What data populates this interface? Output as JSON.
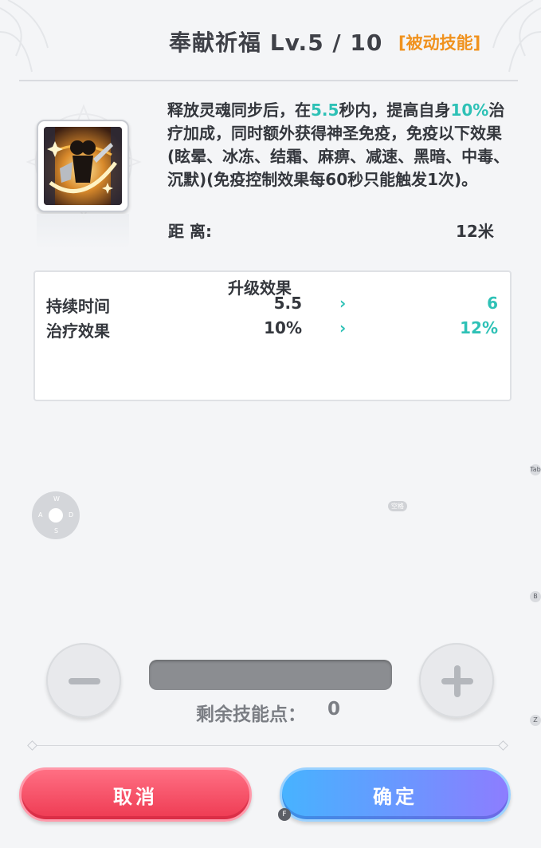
{
  "header": {
    "skill_name": "奉献祈福 Lv.5 / 10",
    "skill_type": "[被动技能]"
  },
  "skill": {
    "icon": "sword-swing-skill-icon",
    "description": [
      {
        "text": "释放灵魂同步后，在",
        "highlight": false
      },
      {
        "text": "5.5",
        "highlight": true
      },
      {
        "text": "秒内，提高自身",
        "highlight": false
      },
      {
        "text": "10%",
        "highlight": true
      },
      {
        "text": "治疗加成，同时额外获得神圣免疫，免疫以下效果(眩晕、冰冻、结霜、麻痹、减速、黑暗、中毒、沉默)(免疫控制效果每60秒只能触发1次)。",
        "highlight": false
      }
    ],
    "range_label": "距  离:",
    "range_value": "12米"
  },
  "upgrade": {
    "title": "升级效果",
    "rows": [
      {
        "label": "持续时间",
        "current": "5.5",
        "arrow": "›",
        "next": "6"
      },
      {
        "label": "治疗效果",
        "current": "10%",
        "arrow": "›",
        "next": "12%"
      }
    ]
  },
  "controls": {
    "wasd": {
      "w": "W",
      "a": "A",
      "s": "S",
      "d": "D"
    },
    "space_hint": "空格",
    "side_keys": [
      "Tab",
      "B",
      "Z"
    ],
    "points_label": "剩余技能点：",
    "points_value": "0",
    "allocated_fraction": 0
  },
  "buttons": {
    "cancel": "取消",
    "confirm": "确定",
    "confirm_key": "F"
  },
  "colors": {
    "highlight": "#2ec1b6",
    "skill_type": "#f0921e",
    "cancel": "#ee3a52",
    "confirm": "#6f93ff"
  }
}
